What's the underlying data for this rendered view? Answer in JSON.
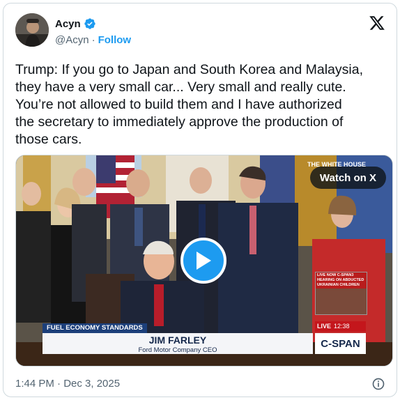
{
  "author": {
    "name": "Acyn",
    "handle": "@Acyn",
    "dot": "·",
    "follow_label": "Follow"
  },
  "icons": {
    "verified": "verified-badge-icon",
    "platform": "x-logo-icon",
    "info": "info-icon",
    "play": "play-icon"
  },
  "colors": {
    "accent": "#1d9bf0",
    "text": "#0f1419",
    "muted": "#536471"
  },
  "tweet": {
    "text": "Trump: If you go to Japan and South Korea and Malaysia,\nthey have a very small car... Very small and really cute.\nYou’re not allowed to build them and I have authorized\nthe secretary to immediately approve the production of\nthose cars."
  },
  "media": {
    "watch_label": "Watch on X",
    "chyron_top": "FUEL ECONOMY STANDARDS",
    "chyron_name": "JIM FARLEY",
    "chyron_title": "Ford Motor Company CEO",
    "network": "C-SPAN",
    "live_label": "LIVE",
    "live_time": "12:38",
    "inset_text": "LIVE NOW C-SPAN3 HEARING ON ABDUCTED UKRAINIAN CHILDREN",
    "banner_text": "THE WHITE HOUSE"
  },
  "timestamp": "1:44 PM · Dec 3, 2025"
}
